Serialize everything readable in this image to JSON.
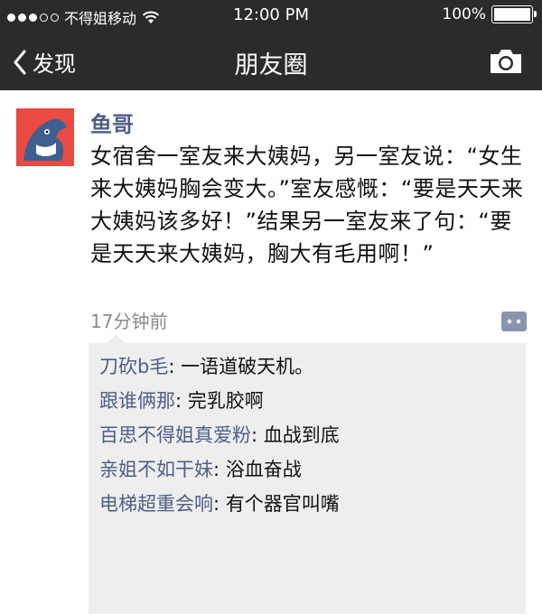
{
  "status_bar": {
    "carrier": "不得姐移动",
    "time": "12:00 PM",
    "battery": "100%"
  },
  "nav": {
    "back_label": "发现",
    "title": "朋友圈"
  },
  "post": {
    "username": "鱼哥",
    "text": "女宿舍一室友来大姨妈，另一室友说：“女生来大姨妈胸会变大。”室友感慨：“要是天天来大姨妈该多好！”结果另一室友来了句：“要是天天来大姨妈，胸大有毛用啊！”",
    "timestamp": "17分钟前",
    "comments": [
      {
        "name": "刀砍b毛",
        "text": ": 一语道破天机。"
      },
      {
        "name": "跟谁俩那",
        "text": ": 完乳胶啊"
      },
      {
        "name": "百思不得姐真爱粉",
        "text": ": 血战到底"
      },
      {
        "name": "亲姐不如干妹",
        "text": ": 浴血奋战"
      },
      {
        "name": "电梯超重会响",
        "text": ": 有个器官叫嘴"
      }
    ]
  },
  "colors": {
    "bar_bg": "#2b2b2b",
    "name_blue": "#4e5f87",
    "comment_bg": "#eeeeee",
    "avatar_red": "#e94a42"
  },
  "icons": {
    "wifi": "wifi-icon",
    "back": "chevron-left-icon",
    "camera": "camera-icon",
    "comment": "comment-icon"
  }
}
